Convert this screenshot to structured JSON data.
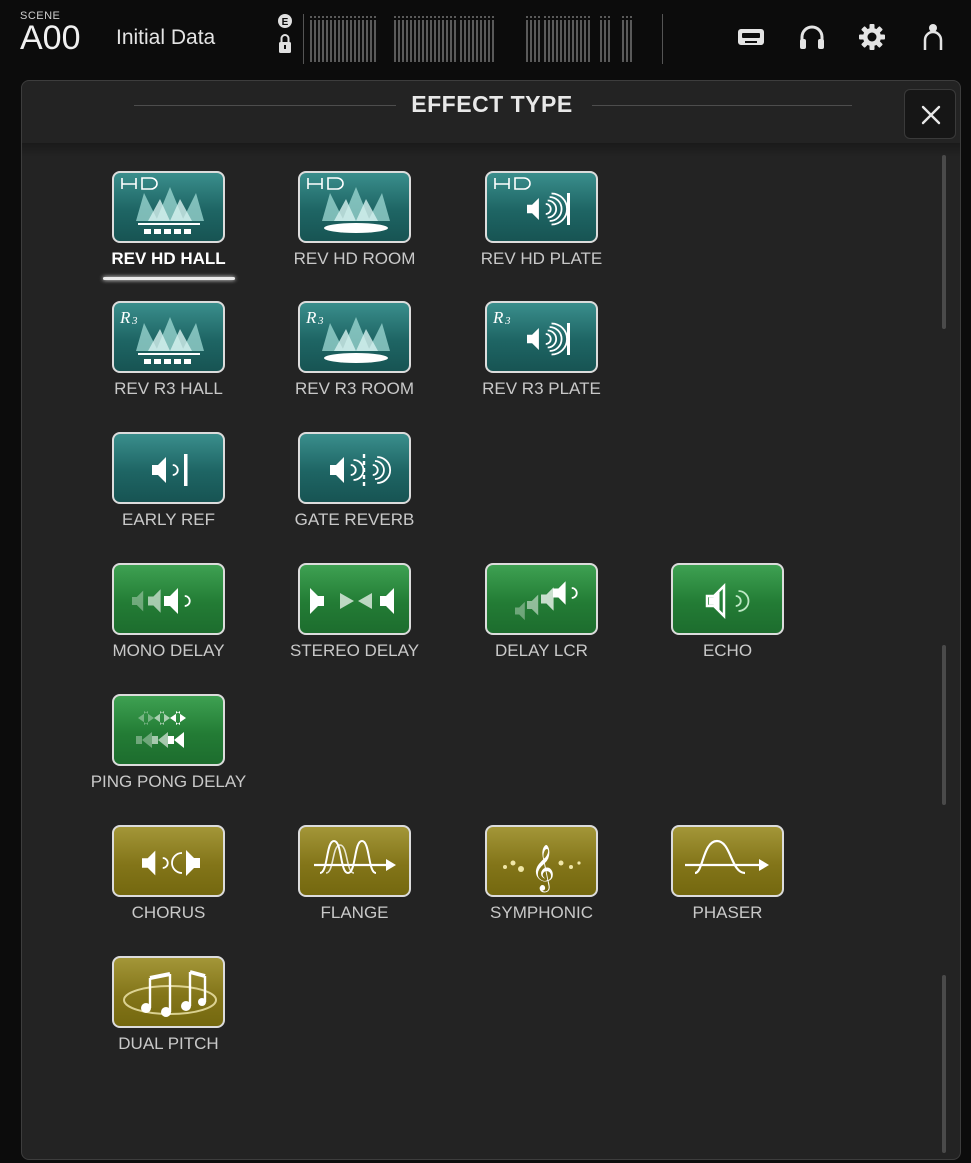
{
  "topbar": {
    "scene_label": "SCENE",
    "scene_number": "A00",
    "scene_name": "Initial Data",
    "icons": [
      "e-badge-icon",
      "lock-icon",
      "meter-bridge",
      "tape-icon",
      "headphones-icon",
      "gear-icon",
      "user-icon"
    ]
  },
  "dialog": {
    "title": "EFFECT TYPE",
    "close_icon": "close-icon",
    "effects": [
      {
        "label": "REV HD HALL",
        "icon": "hd-hall-icon",
        "color": "teal",
        "selected": true
      },
      {
        "label": "REV HD ROOM",
        "icon": "hd-room-icon",
        "color": "teal",
        "selected": false
      },
      {
        "label": "REV HD PLATE",
        "icon": "hd-plate-icon",
        "color": "teal",
        "selected": false
      },
      {
        "label": "REV R3 HALL",
        "icon": "r3-hall-icon",
        "color": "teal",
        "selected": false
      },
      {
        "label": "REV R3 ROOM",
        "icon": "r3-room-icon",
        "color": "teal",
        "selected": false
      },
      {
        "label": "REV R3 PLATE",
        "icon": "r3-plate-icon",
        "color": "teal",
        "selected": false
      },
      {
        "label": "EARLY REF",
        "icon": "early-ref-icon",
        "color": "teal",
        "selected": false
      },
      {
        "label": "GATE REVERB",
        "icon": "gate-reverb-icon",
        "color": "teal",
        "selected": false
      },
      {
        "label": "MONO DELAY",
        "icon": "mono-delay-icon",
        "color": "green",
        "selected": false
      },
      {
        "label": "STEREO DELAY",
        "icon": "stereo-delay-icon",
        "color": "green",
        "selected": false
      },
      {
        "label": "DELAY LCR",
        "icon": "delay-lcr-icon",
        "color": "green",
        "selected": false
      },
      {
        "label": "ECHO",
        "icon": "echo-icon",
        "color": "green",
        "selected": false
      },
      {
        "label": "PING PONG DELAY",
        "icon": "ping-pong-delay-icon",
        "color": "green",
        "selected": false
      },
      {
        "label": "CHORUS",
        "icon": "chorus-icon",
        "color": "olive",
        "selected": false
      },
      {
        "label": "FLANGE",
        "icon": "flange-icon",
        "color": "olive",
        "selected": false
      },
      {
        "label": "SYMPHONIC",
        "icon": "symphonic-icon",
        "color": "olive",
        "selected": false
      },
      {
        "label": "PHASER",
        "icon": "phaser-icon",
        "color": "olive",
        "selected": false
      },
      {
        "label": "DUAL PITCH",
        "icon": "dual-pitch-icon",
        "color": "olive",
        "selected": false
      }
    ]
  },
  "colors": {
    "teal": "#1e6564",
    "green": "#237c35",
    "olive": "#837519",
    "background": "#232323"
  }
}
